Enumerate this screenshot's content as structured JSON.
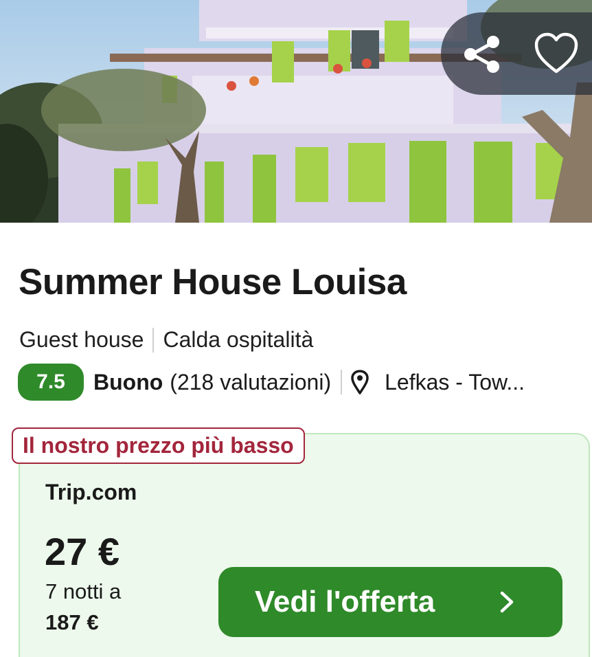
{
  "hotel": {
    "name": "Summer House Louisa",
    "type": "Guest house",
    "tagline": "Calda ospitalità",
    "rating_score": "7.5",
    "rating_word": "Buono",
    "reviews": "(218 valutazioni)",
    "location": "Lefkas - Tow..."
  },
  "offer": {
    "badge": "Il nostro prezzo più basso",
    "provider": "Trip.com",
    "price": "27 €",
    "nights_text": "7 notti a",
    "total_price": "187 €",
    "cta_label": "Vedi l'offerta"
  },
  "icons": {
    "share": "share-icon",
    "favorite": "heart-icon",
    "location": "map-pin-icon",
    "cta_arrow": "chevron-right-icon"
  },
  "colors": {
    "brand_green": "#2f8a2a",
    "card_background": "#edf9ec",
    "badge_red": "#a3263c"
  }
}
